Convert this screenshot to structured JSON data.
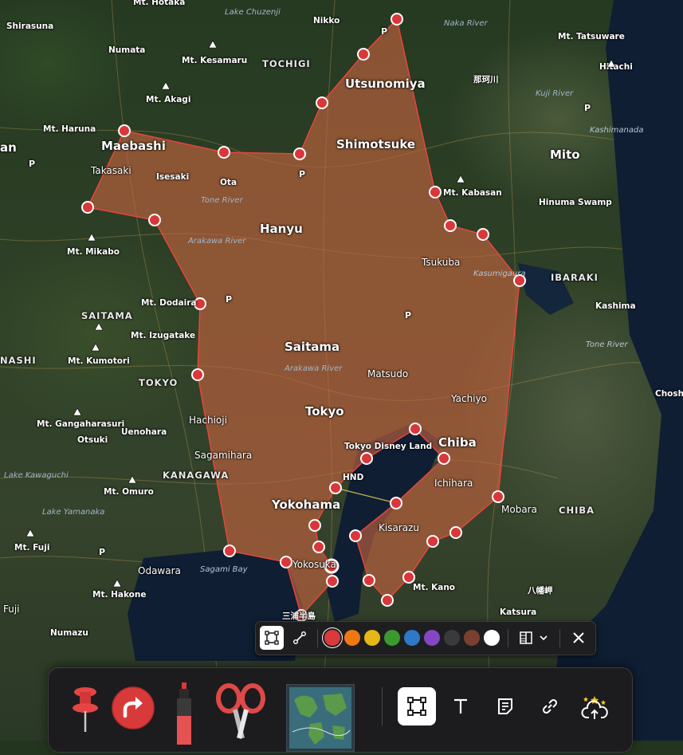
{
  "map": {
    "labels": {
      "hotaka": "Mt. Hotaka",
      "lake_chuzenji": "Lake Chuzenji",
      "nikko": "Nikko",
      "naka_river": "Naka River",
      "shirasuna": "Shirasuna",
      "mt_tatsuware": "Mt. Tatsuware",
      "numata": "Numata",
      "mt_kesamaru": "Mt. Kesamaru",
      "tochigi": "TOCHIGI",
      "hitachi": "Hitachi",
      "utsunomiya": "Utsunomiya",
      "naka_kanji": "那珂川",
      "mt_akagi": "Mt. Akagi",
      "kuji_river": "Kuji River",
      "mt_haruna": "Mt. Haruna",
      "kashimanada": "Kashimanada",
      "maebashi": "Maebashi",
      "shimotsuke": "Shimotsuke",
      "mito": "Mito",
      "takasaki": "Takasaki",
      "isesaki": "Isesaki",
      "ota": "Ota",
      "mt_kabasan": "Mt. Kabasan",
      "tone_river": "Tone River",
      "hinuma_swamp": "Hinuma Swamp",
      "hanyu": "Hanyu",
      "arakawa_river": "Arakawa River",
      "mt_mikabo": "Mt. Mikabo",
      "tsukuba": "Tsukuba",
      "kasumigaura": "Kasumigaura",
      "ibaraki": "IBARAKI",
      "mt_dodaira": "Mt. Dodaira",
      "kashima": "Kashima",
      "saitama_pref": "SAITAMA",
      "mt_izugatake": "Mt. Izugatake",
      "tone_river_2": "Tone River",
      "saitama": "Saitama",
      "arakawa_river_2": "Arakawa River",
      "nashi": "NASHI",
      "mt_kumotori": "Mt. Kumotori",
      "matsudo": "Matsudo",
      "tokyo_pref": "TOKYO",
      "yachiyo": "Yachiyo",
      "chosh": "Chosh",
      "mt_gangaharasuri": "Mt. Gangaharasuri",
      "hachioji": "Hachioji",
      "tokyo": "Tokyo",
      "otsuki": "Otsuki",
      "uenohara": "Uenohara",
      "tokyo_disney": "Tokyo Disney Land",
      "chiba": "Chiba",
      "sagamihara": "Sagamihara",
      "lake_kawaguchi": "Lake Kawaguchi",
      "kanagawa": "KANAGAWA",
      "hnd": "HND",
      "ichihara": "Ichihara",
      "mt_omuro": "Mt. Omuro",
      "yokohama": "Yokohama",
      "mobara": "Mobara",
      "chiba_pref": "CHIBA",
      "lake_yamanaka": "Lake Yamanaka",
      "kisarazu": "Kisarazu",
      "mt_fuji": "Mt. Fuji",
      "sagami_bay": "Sagami Bay",
      "yokosuka": "Yokosuka",
      "odawara": "Odawara",
      "mt_kano": "Mt. Kano",
      "mt_hakone": "Mt. Hakone",
      "hachiman": "八幡岬",
      "fuji": "Fuji",
      "miura_kanji": "三浦半島",
      "katsura": "Katsura",
      "numazu": "Numazu",
      "man": "an",
      "p": "P"
    }
  },
  "annotation": {
    "fill_color": "#c8643f",
    "stroke_color": "#e8453c",
    "vertex_color": "#d9373a"
  },
  "anno_toolbar": {
    "colors": [
      "#d93a3a",
      "#ee7812",
      "#e6b716",
      "#3a9a2e",
      "#2f78c8",
      "#8446c2",
      "#3a3a3c",
      "#7a3f2e",
      "#ffffff"
    ],
    "selected_color": "#d93a3a"
  },
  "dock": {
    "items": [
      "pin-icon",
      "redo-arrow-icon",
      "marker-pen-icon",
      "scissors-icon",
      "map-thumbnail"
    ],
    "tools": [
      "shape-tool-icon",
      "text-tool-icon",
      "note-icon",
      "link-icon",
      "cloud-upload-icon"
    ]
  }
}
